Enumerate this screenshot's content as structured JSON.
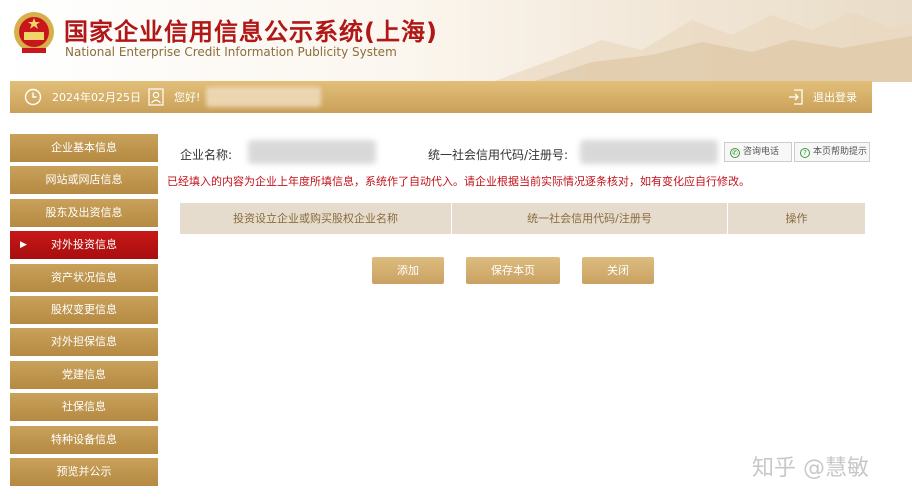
{
  "header": {
    "title_cn": "国家企业信用信息公示系统(上海)",
    "title_en": "National Enterprise Credit Information Publicity System"
  },
  "topbar": {
    "date": "2024年02月25日",
    "greeting": "您好!",
    "logout": "退出登录"
  },
  "sidebar": {
    "items": [
      {
        "label": "企业基本信息"
      },
      {
        "label": "网站或网店信息"
      },
      {
        "label": "股东及出资信息"
      },
      {
        "label": "对外投资信息",
        "active": true
      },
      {
        "label": "资产状况信息"
      },
      {
        "label": "股权变更信息"
      },
      {
        "label": "对外担保信息"
      },
      {
        "label": "党建信息"
      },
      {
        "label": "社保信息"
      },
      {
        "label": "特种设备信息"
      },
      {
        "label": "预览并公示"
      }
    ]
  },
  "main": {
    "company_name_label": "企业名称:",
    "credit_code_label": "统一社会信用代码/注册号:",
    "consult_phone": "咨询电话",
    "help": "本页帮助提示",
    "notice": "已经填入的内容为企业上年度所填信息，系统作了自动代入。请企业根据当前实际情况逐条核对，如有变化应自行修改。",
    "table": {
      "headers": [
        "投资设立企业或购买股权企业名称",
        "统一社会信用代码/注册号",
        "操作"
      ]
    },
    "buttons": {
      "add": "添加",
      "save": "保存本页",
      "close": "关闭"
    }
  },
  "watermark": "知乎 @慧敏",
  "colors": {
    "gold": "#c9a058",
    "red": "#c81818",
    "notice_red": "#c0121a",
    "table_header": "#e5dccd"
  }
}
